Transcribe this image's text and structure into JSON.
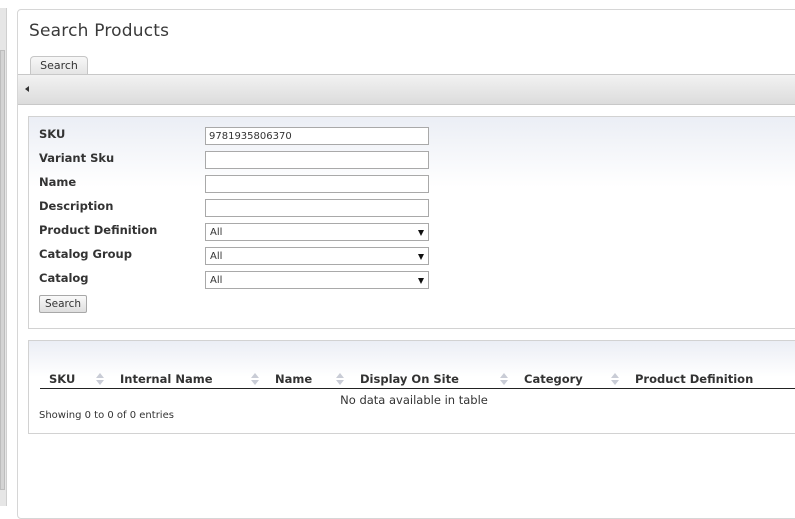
{
  "page": {
    "title": "Search Products",
    "tab_label": "Search"
  },
  "form": {
    "sku_label": "SKU",
    "sku_value": "9781935806370",
    "variant_sku_label": "Variant Sku",
    "variant_sku_value": "",
    "name_label": "Name",
    "name_value": "",
    "description_label": "Description",
    "description_value": "",
    "product_definition_label": "Product Definition",
    "product_definition_value": "All",
    "catalog_group_label": "Catalog Group",
    "catalog_group_value": "All",
    "catalog_label": "Catalog",
    "catalog_value": "All",
    "search_button": "Search"
  },
  "results": {
    "columns": [
      "SKU",
      "Internal Name",
      "Name",
      "Display On Site",
      "Category",
      "Product Definition"
    ],
    "empty_message": "No data available in table",
    "info": "Showing 0 to 0 of 0 entries"
  },
  "icons": {
    "collapse": "triangle-left-icon",
    "sort": "sort-both-icon",
    "dropdown": "chevron-down-icon"
  }
}
